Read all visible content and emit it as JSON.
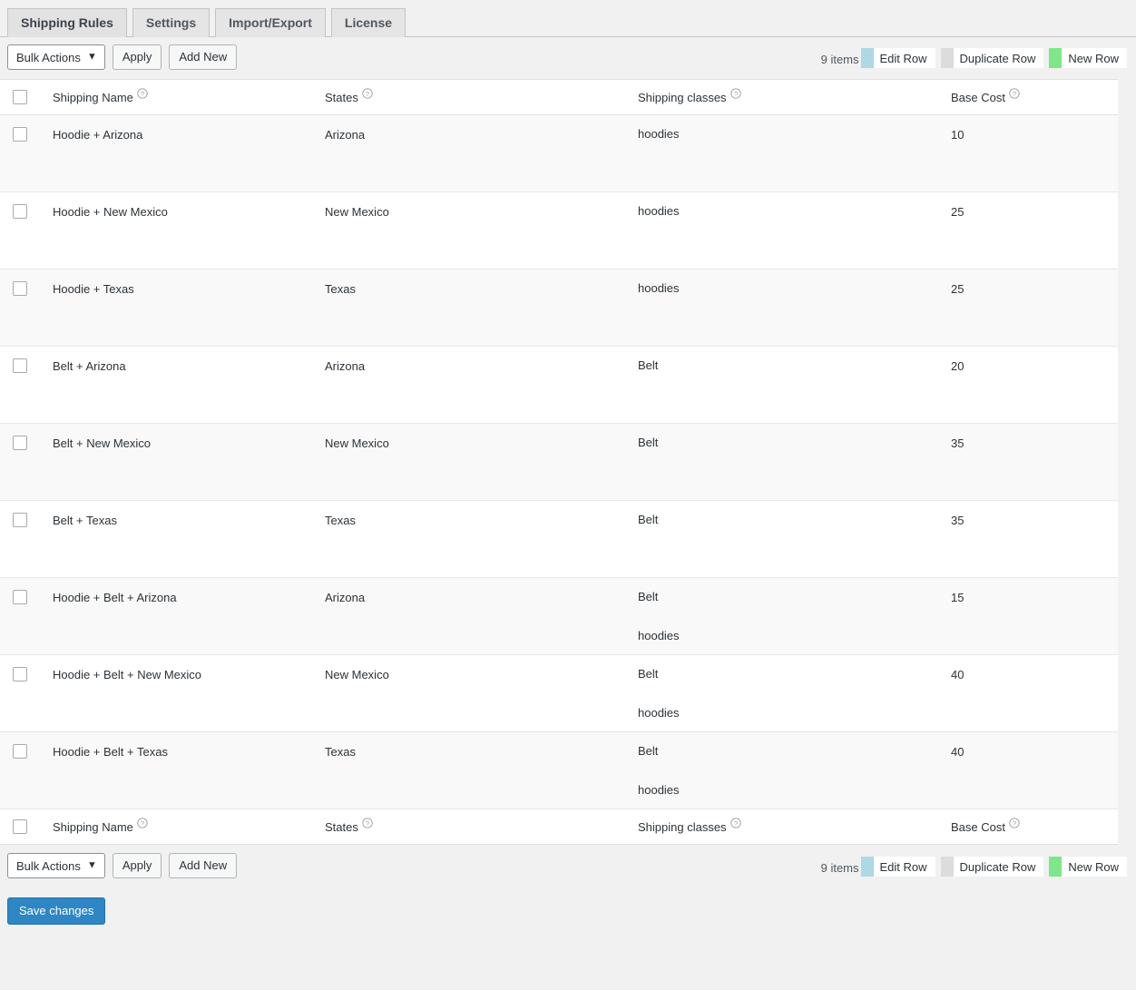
{
  "tabs": [
    {
      "label": "Shipping Rules",
      "active": true
    },
    {
      "label": "Settings",
      "active": false
    },
    {
      "label": "Import/Export",
      "active": false
    },
    {
      "label": "License",
      "active": false
    }
  ],
  "toolbar": {
    "bulk_actions_label": "Bulk Actions",
    "apply_label": "Apply",
    "add_new_label": "Add New",
    "items_count": "9 items",
    "legend": [
      {
        "label": "Edit Row",
        "color": "#add8e6",
        "icon": "swatch-edit-row"
      },
      {
        "label": "Duplicate Row",
        "color": "#dcdcdc",
        "icon": "swatch-duplicate-row"
      },
      {
        "label": "New Row",
        "color": "#7ee787",
        "icon": "swatch-new-row"
      }
    ]
  },
  "table": {
    "columns": [
      {
        "key": "name",
        "label": "Shipping Name",
        "help": true
      },
      {
        "key": "state",
        "label": "States",
        "help": true
      },
      {
        "key": "class",
        "label": "Shipping classes",
        "help": true
      },
      {
        "key": "cost",
        "label": "Base Cost",
        "help": true
      }
    ],
    "rows": [
      {
        "name": "Hoodie + Arizona",
        "state": "Arizona",
        "classes": [
          "hoodies"
        ],
        "cost": "10"
      },
      {
        "name": "Hoodie + New Mexico",
        "state": "New Mexico",
        "classes": [
          "hoodies"
        ],
        "cost": "25"
      },
      {
        "name": "Hoodie + Texas",
        "state": "Texas",
        "classes": [
          "hoodies"
        ],
        "cost": "25"
      },
      {
        "name": "Belt + Arizona",
        "state": "Arizona",
        "classes": [
          "Belt"
        ],
        "cost": "20"
      },
      {
        "name": "Belt + New Mexico",
        "state": "New Mexico",
        "classes": [
          "Belt"
        ],
        "cost": "35"
      },
      {
        "name": "Belt + Texas",
        "state": "Texas",
        "classes": [
          "Belt"
        ],
        "cost": "35"
      },
      {
        "name": "Hoodie + Belt + Arizona",
        "state": "Arizona",
        "classes": [
          "Belt",
          "hoodies"
        ],
        "cost": "15"
      },
      {
        "name": "Hoodie + Belt + New Mexico",
        "state": "New Mexico",
        "classes": [
          "Belt",
          "hoodies"
        ],
        "cost": "40"
      },
      {
        "name": "Hoodie + Belt + Texas",
        "state": "Texas",
        "classes": [
          "Belt",
          "hoodies"
        ],
        "cost": "40"
      }
    ]
  },
  "submit": {
    "save_label": "Save changes"
  },
  "colors": {
    "primary_button": "#2e87c4",
    "page_background": "#f1f1f1",
    "row_alt_background": "#f9f9f9"
  }
}
